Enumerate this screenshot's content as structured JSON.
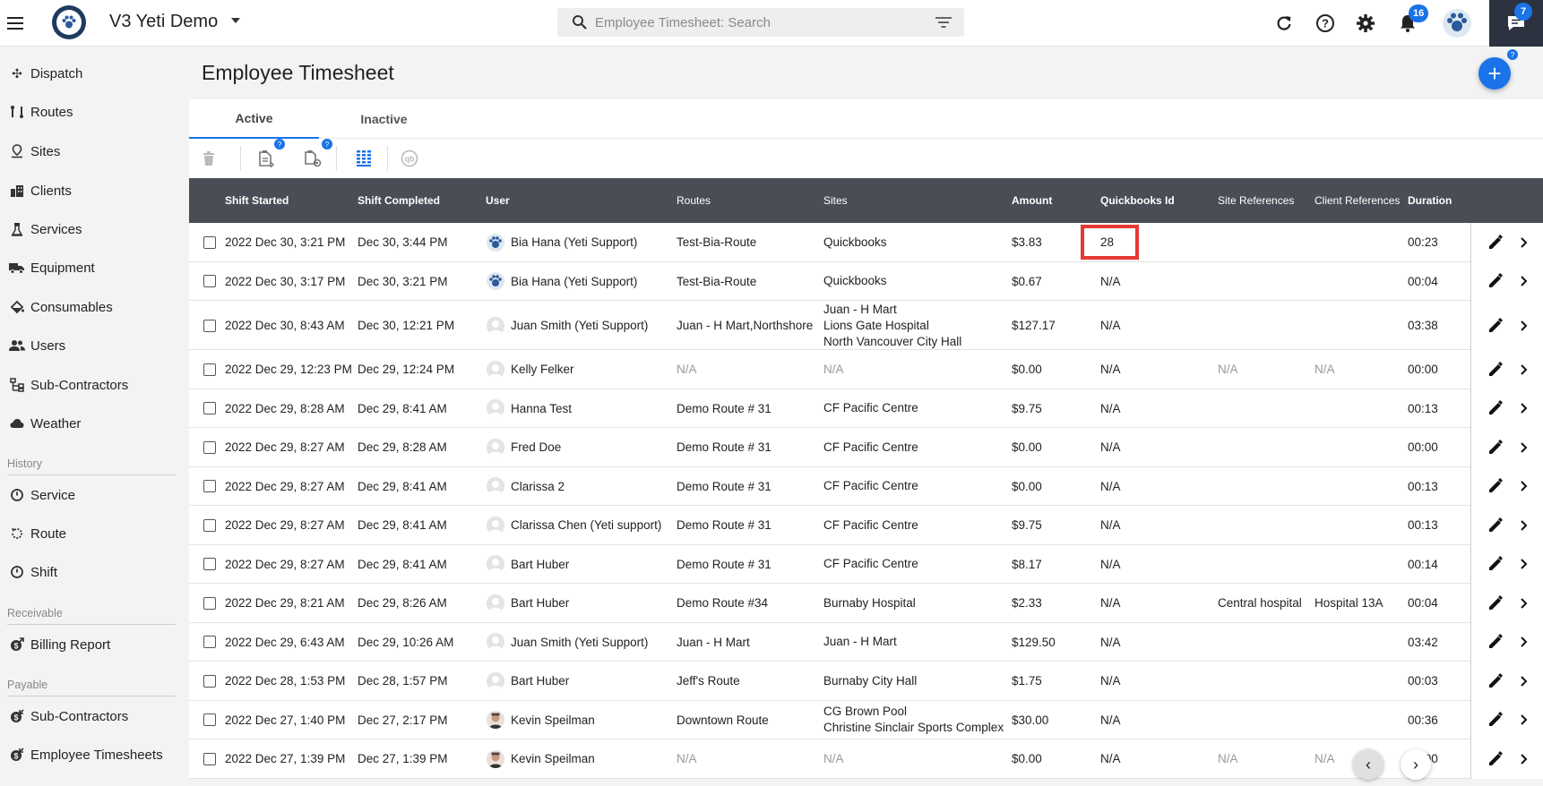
{
  "app": {
    "title": "V3 Yeti Demo"
  },
  "search": {
    "placeholder": "Employee Timesheet: Search"
  },
  "topbar": {
    "notifications_count": "16",
    "chat_count": "7"
  },
  "sidebar": {
    "main_items": [
      {
        "label": "Dispatch",
        "icon": "dispatch-icon"
      },
      {
        "label": "Routes",
        "icon": "routes-icon"
      },
      {
        "label": "Sites",
        "icon": "sites-icon"
      },
      {
        "label": "Clients",
        "icon": "clients-icon"
      },
      {
        "label": "Services",
        "icon": "services-icon"
      },
      {
        "label": "Equipment",
        "icon": "equipment-icon"
      },
      {
        "label": "Consumables",
        "icon": "consumables-icon"
      },
      {
        "label": "Users",
        "icon": "users-icon"
      },
      {
        "label": "Sub-Contractors",
        "icon": "sub-contractors-icon"
      },
      {
        "label": "Weather",
        "icon": "weather-icon"
      }
    ],
    "history_heading": "History",
    "history_items": [
      {
        "label": "Service"
      },
      {
        "label": "Route"
      },
      {
        "label": "Shift"
      }
    ],
    "receivable_heading": "Receivable",
    "receivable_items": [
      {
        "label": "Billing Report"
      }
    ],
    "payable_heading": "Payable",
    "payable_items": [
      {
        "label": "Sub-Contractors"
      },
      {
        "label": "Employee Timesheets"
      }
    ]
  },
  "page": {
    "title": "Employee Timesheet"
  },
  "tabs": [
    {
      "label": "Active",
      "active": true
    },
    {
      "label": "Inactive",
      "active": false
    }
  ],
  "table": {
    "columns": [
      "Shift Started",
      "Shift Completed",
      "User",
      "Routes",
      "Sites",
      "Amount",
      "Quickbooks Id",
      "Site References",
      "Client References",
      "Duration"
    ],
    "rows": [
      {
        "started": "2022 Dec 30, 3:21 PM",
        "completed": "Dec 30, 3:44 PM",
        "user": "Bia Hana (Yeti Support)",
        "avatar": "yeti",
        "routes": "Test-Bia-Route",
        "sites": [
          "Quickbooks"
        ],
        "amount": "$3.83",
        "qb": "28",
        "site_ref": "",
        "client_ref": "",
        "duration": "00:23",
        "highlight": true
      },
      {
        "started": "2022 Dec 30, 3:17 PM",
        "completed": "Dec 30, 3:21 PM",
        "user": "Bia Hana (Yeti Support)",
        "avatar": "yeti",
        "routes": "Test-Bia-Route",
        "sites": [
          "Quickbooks"
        ],
        "amount": "$0.67",
        "qb": "N/A",
        "site_ref": "",
        "client_ref": "",
        "duration": "00:04"
      },
      {
        "started": "2022 Dec 30, 8:43 AM",
        "completed": "Dec 30, 12:21 PM",
        "user": "Juan Smith (Yeti Support)",
        "avatar": "default",
        "routes": "Juan - H Mart,Northshore",
        "sites": [
          "Juan - H Mart",
          "Lions Gate Hospital",
          "North Vancouver City Hall"
        ],
        "amount": "$127.17",
        "qb": "N/A",
        "site_ref": "",
        "client_ref": "",
        "duration": "03:38"
      },
      {
        "started": "2022 Dec 29, 12:23 PM",
        "completed": "Dec 29, 12:24 PM",
        "user": "Kelly Felker",
        "avatar": "default",
        "routes": "N/A",
        "sites": [
          "N/A"
        ],
        "amount": "$0.00",
        "qb": "N/A",
        "site_ref": "N/A",
        "client_ref": "N/A",
        "duration": "00:00",
        "muted": true
      },
      {
        "started": "2022 Dec 29, 8:28 AM",
        "completed": "Dec 29, 8:41 AM",
        "user": "Hanna Test",
        "avatar": "default",
        "routes": "Demo Route # 31",
        "sites": [
          "CF Pacific Centre"
        ],
        "amount": "$9.75",
        "qb": "N/A",
        "site_ref": "",
        "client_ref": "",
        "duration": "00:13"
      },
      {
        "started": "2022 Dec 29, 8:27 AM",
        "completed": "Dec 29, 8:28 AM",
        "user": "Fred Doe",
        "avatar": "default",
        "routes": "Demo Route # 31",
        "sites": [
          "CF Pacific Centre"
        ],
        "amount": "$0.00",
        "qb": "N/A",
        "site_ref": "",
        "client_ref": "",
        "duration": "00:00"
      },
      {
        "started": "2022 Dec 29, 8:27 AM",
        "completed": "Dec 29, 8:41 AM",
        "user": "Clarissa 2",
        "avatar": "default",
        "routes": "Demo Route # 31",
        "sites": [
          "CF Pacific Centre"
        ],
        "amount": "$0.00",
        "qb": "N/A",
        "site_ref": "",
        "client_ref": "",
        "duration": "00:13"
      },
      {
        "started": "2022 Dec 29, 8:27 AM",
        "completed": "Dec 29, 8:41 AM",
        "user": "Clarissa Chen (Yeti support)",
        "avatar": "default",
        "routes": "Demo Route # 31",
        "sites": [
          "CF Pacific Centre"
        ],
        "amount": "$9.75",
        "qb": "N/A",
        "site_ref": "",
        "client_ref": "",
        "duration": "00:13"
      },
      {
        "started": "2022 Dec 29, 8:27 AM",
        "completed": "Dec 29, 8:41 AM",
        "user": "Bart Huber",
        "avatar": "default",
        "routes": "Demo Route # 31",
        "sites": [
          "CF Pacific Centre"
        ],
        "amount": "$8.17",
        "qb": "N/A",
        "site_ref": "",
        "client_ref": "",
        "duration": "00:14"
      },
      {
        "started": "2022 Dec 29, 8:21 AM",
        "completed": "Dec 29, 8:26 AM",
        "user": "Bart Huber",
        "avatar": "default",
        "routes": "Demo Route #34",
        "sites": [
          "Burnaby Hospital"
        ],
        "amount": "$2.33",
        "qb": "N/A",
        "site_ref": "Central hospital",
        "client_ref": "Hospital 13A",
        "duration": "00:04"
      },
      {
        "started": "2022 Dec 29, 6:43 AM",
        "completed": "Dec 29, 10:26 AM",
        "user": "Juan Smith (Yeti Support)",
        "avatar": "default",
        "routes": "Juan - H Mart",
        "sites": [
          "Juan - H Mart"
        ],
        "amount": "$129.50",
        "qb": "N/A",
        "site_ref": "",
        "client_ref": "",
        "duration": "03:42"
      },
      {
        "started": "2022 Dec 28, 1:53 PM",
        "completed": "Dec 28, 1:57 PM",
        "user": "Bart Huber",
        "avatar": "default",
        "routes": "Jeff's Route",
        "sites": [
          "Burnaby City Hall"
        ],
        "amount": "$1.75",
        "qb": "N/A",
        "site_ref": "",
        "client_ref": "",
        "duration": "00:03"
      },
      {
        "started": "2022 Dec 27, 1:40 PM",
        "completed": "Dec 27, 2:17 PM",
        "user": "Kevin Speilman",
        "avatar": "photo",
        "routes": "Downtown Route",
        "sites": [
          "CG Brown Pool",
          "Christine Sinclair Sports Complex"
        ],
        "amount": "$30.00",
        "qb": "N/A",
        "site_ref": "",
        "client_ref": "",
        "duration": "00:36"
      },
      {
        "started": "2022 Dec 27, 1:39 PM",
        "completed": "Dec 27, 1:39 PM",
        "user": "Kevin Speilman",
        "avatar": "photo",
        "routes": "N/A",
        "sites": [
          "N/A"
        ],
        "amount": "$0.00",
        "qb": "N/A",
        "site_ref": "N/A",
        "client_ref": "N/A",
        "duration": "00:00",
        "muted": true
      }
    ]
  },
  "colors": {
    "accent": "#1a73e8",
    "header_bg": "#4a4d55",
    "highlight": "#e53935"
  }
}
